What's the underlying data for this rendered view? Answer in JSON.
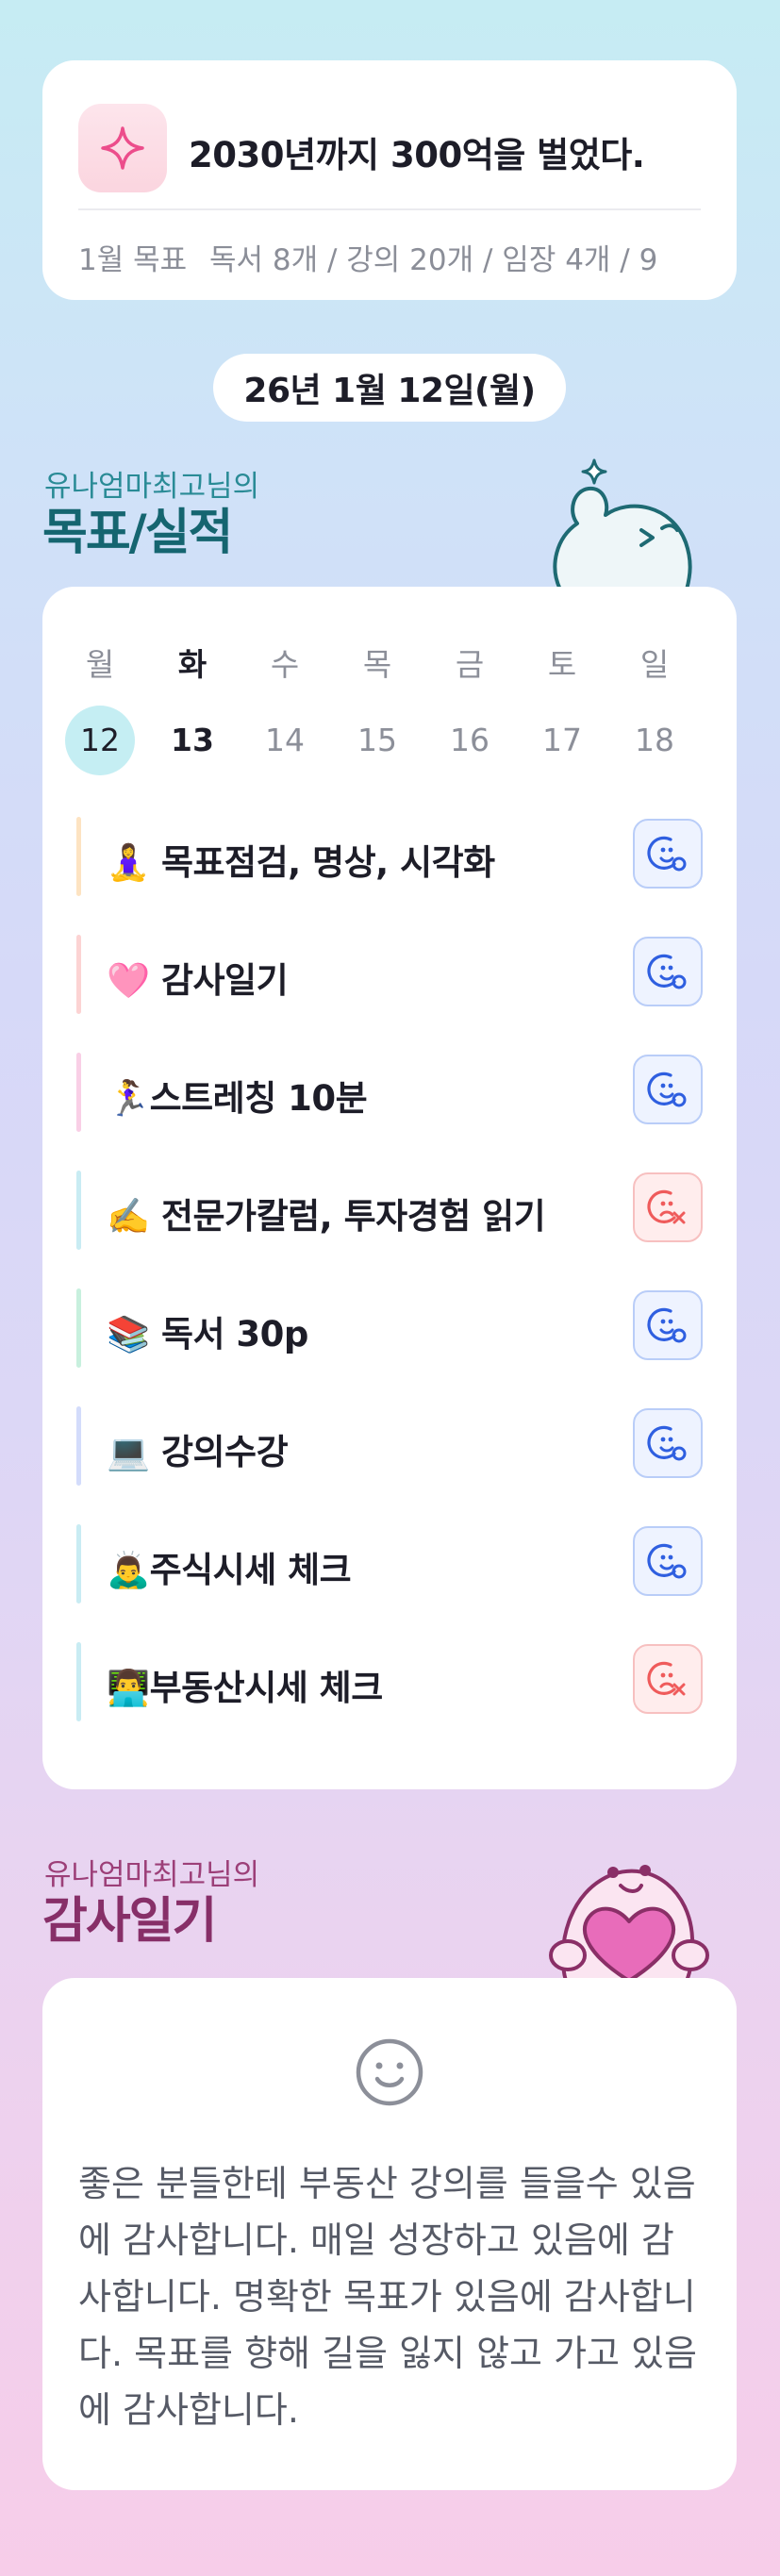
{
  "goal": {
    "icon": "sparkle-icon",
    "title": "2030년까지 300억을 벌었다.",
    "monthly_label": "1월 목표",
    "monthly_text": "독서 8개 / 강의 20개 / 임장 4개 / 9"
  },
  "date": "26년 1월 12일(월)",
  "goals_section": {
    "subtitle": "유나엄마최고님의",
    "title": "목표/실적",
    "mascot": "waving-ghost-mascot"
  },
  "week": [
    {
      "name": "월",
      "num": "12",
      "state": "today"
    },
    {
      "name": "화",
      "num": "13",
      "state": "strong"
    },
    {
      "name": "수",
      "num": "14",
      "state": "normal"
    },
    {
      "name": "목",
      "num": "15",
      "state": "normal"
    },
    {
      "name": "금",
      "num": "16",
      "state": "normal"
    },
    {
      "name": "토",
      "num": "17",
      "state": "normal"
    },
    {
      "name": "일",
      "num": "18",
      "state": "normal"
    }
  ],
  "tasks": [
    {
      "label": "🧘‍♀️ 목표점검, 명상, 시각화",
      "status": "done",
      "bar": "#fde3c2"
    },
    {
      "label": "🩷 감사일기",
      "status": "done",
      "bar": "#fcd3d3"
    },
    {
      "label": "🏃‍♀️스트레칭 10분",
      "status": "done",
      "bar": "#f9cfe6"
    },
    {
      "label": "✍️ 전문가칼럼, 투자경험 읽기",
      "status": "miss",
      "bar": "#c9ecf3"
    },
    {
      "label": "📚 독서 30p",
      "status": "done",
      "bar": "#c8f0de"
    },
    {
      "label": "💻 강의수강",
      "status": "done",
      "bar": "#d3dcfb"
    },
    {
      "label": "🙇‍♂️주식시세 체크",
      "status": "done",
      "bar": "#c9ecf3"
    },
    {
      "label": "👨‍💻부동산시세 체크",
      "status": "miss",
      "bar": "#c9ecf3"
    }
  ],
  "status_icons": {
    "done": "smile-check-icon",
    "miss": "sad-x-icon"
  },
  "colors": {
    "done": "#2f5fe0",
    "miss": "#ef5b5b",
    "accent_teal": "#156570",
    "accent_pink": "#872f68"
  },
  "gratitude_section": {
    "subtitle": "유나엄마최고님의",
    "title": "감사일기",
    "mascot": "heart-hug-mascot"
  },
  "gratitude": {
    "icon": "smile-face-icon",
    "text": "좋은 분들한테 부동산 강의를 들을수 있음에 감사합니다. 매일 성장하고 있음에 감사합니다. 명확한 목표가 있음에 감사합니다. 목표를 향해 길을 잃지 않고 가고 있음에 감사합니다."
  }
}
